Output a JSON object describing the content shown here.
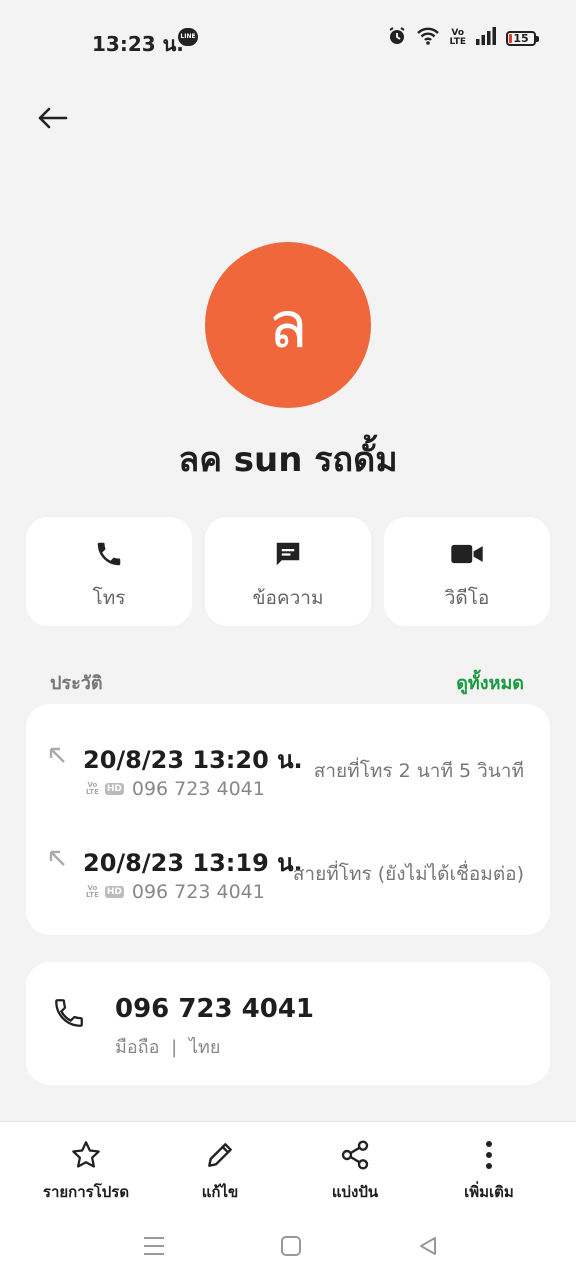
{
  "status_bar": {
    "time": "13:23 น.",
    "line_label": "LINE",
    "volte_top": "Vo",
    "volte_bottom": "LTE",
    "battery_level": "15",
    "battery_color": "#e53935",
    "icons": [
      "alarm-icon",
      "wifi-icon",
      "volte-icon",
      "signal-icon",
      "battery-icon"
    ]
  },
  "contact": {
    "avatar_letter": "ล",
    "avatar_color": "#f0673c",
    "name": "ลค sun รถดั้ม"
  },
  "actions": [
    {
      "label": "โทร",
      "icon": "phone-icon"
    },
    {
      "label": "ข้อความ",
      "icon": "message-icon"
    },
    {
      "label": "วิดีโอ",
      "icon": "video-icon"
    }
  ],
  "history": {
    "title": "ประวัติ",
    "see_all": "ดูทั้งหมด",
    "see_all_color": "#1a9a41",
    "calls": [
      {
        "datetime": "20/8/23 13:20 น.",
        "number": "096 723 4041",
        "status": "สายที่โทร  2 นาที 5 วินาที",
        "hd": "HD",
        "volte_top": "Vo",
        "volte_bottom": "LTE"
      },
      {
        "datetime": "20/8/23 13:19 น.",
        "number": "096 723 4041",
        "status": "สายที่โทร (ยังไม่ได้เชื่อมต่อ)",
        "hd": "HD",
        "volte_top": "Vo",
        "volte_bottom": "LTE"
      }
    ]
  },
  "phone_entry": {
    "number": "096 723 4041",
    "type": "มือถือ",
    "separator": "|",
    "region": "ไทย"
  },
  "bottom_actions": [
    {
      "label": "รายการโปรด",
      "icon": "star-icon"
    },
    {
      "label": "แก้ไข",
      "icon": "pencil-icon"
    },
    {
      "label": "แบ่งปัน",
      "icon": "share-icon"
    },
    {
      "label": "เพิ่มเติม",
      "icon": "more-icon"
    }
  ],
  "nav": [
    "menu-icon",
    "home-icon",
    "back-triangle-icon"
  ]
}
